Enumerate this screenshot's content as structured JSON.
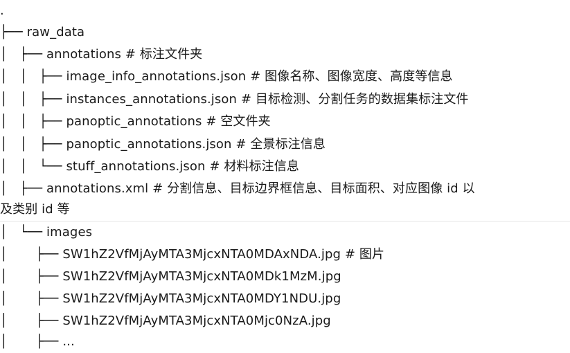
{
  "tree": {
    "root": ".",
    "lines": [
      {
        "prefix": "├── ",
        "name": "raw_data",
        "comment": ""
      },
      {
        "prefix": "│   ├── ",
        "name": "annotations",
        "comment": "# 标注文件夹"
      },
      {
        "prefix": "│   │   ├── ",
        "name": "image_info_annotations.json",
        "comment": "# 图像名称、图像宽度、高度等信息"
      },
      {
        "prefix": "│   │   ├── ",
        "name": "instances_annotations.json",
        "comment": "# 目标检测、分割任务的数据集标注文件"
      },
      {
        "prefix": "│   │   ├── ",
        "name": "panoptic_annotations",
        "comment": "# 空文件夹"
      },
      {
        "prefix": "│   │   ├── ",
        "name": "panoptic_annotations.json",
        "comment": "# 全景标注信息"
      },
      {
        "prefix": "│   │   └── ",
        "name": "stuff_annotations.json",
        "comment": "# 材料标注信息"
      },
      {
        "prefix": "│   ├── ",
        "name": "annotations.xml",
        "comment": "# 分割信息、目标边界框信息、目标面积、对应图像 id 以"
      },
      {
        "prefix": "",
        "name": "",
        "comment": "及类别 id 等"
      },
      {
        "prefix": "│   └── ",
        "name": "images",
        "comment": ""
      },
      {
        "prefix": "│       ├── ",
        "name": "SW1hZ2VfMjAyMTA3MjcxNTA0MDAxNDA.jpg",
        "comment": "# 图片"
      },
      {
        "prefix": "│       ├── ",
        "name": "SW1hZ2VfMjAyMTA3MjcxNTA0MDk1MzM.jpg",
        "comment": ""
      },
      {
        "prefix": "│       ├── ",
        "name": "SW1hZ2VfMjAyMTA3MjcxNTA0MDY1NDU.jpg",
        "comment": ""
      },
      {
        "prefix": "│       ├── ",
        "name": "SW1hZ2VfMjAyMTA3MjcxNTA0Mjc0NzA.jpg",
        "comment": ""
      },
      {
        "prefix": "│       ├── ",
        "name": "...",
        "comment": ""
      }
    ]
  }
}
